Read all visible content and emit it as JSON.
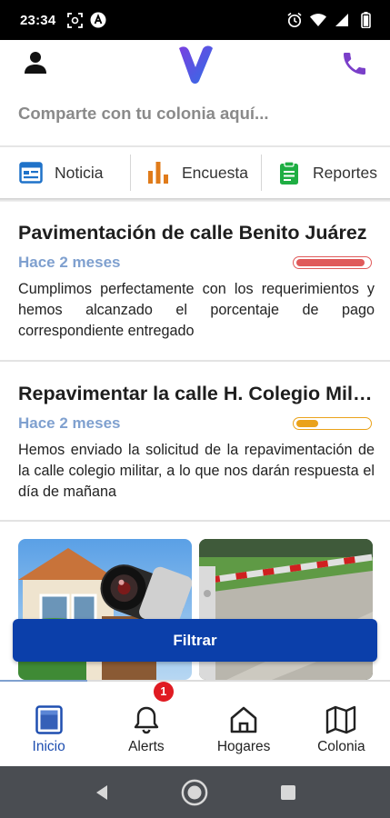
{
  "status_bar": {
    "time": "23:34",
    "left_icons": [
      "screenshot-icon",
      "app-icon"
    ],
    "right_icons": [
      "alarm-icon",
      "wifi-icon",
      "signal-icon",
      "battery-icon"
    ]
  },
  "header": {
    "share_placeholder": "Comparte con tu colonia aquí...",
    "logo_color": "#5a3fd6",
    "phone_color": "#7a3fc9"
  },
  "categories": [
    {
      "label": "Noticia",
      "icon": "newspaper-icon",
      "color": "#1f72c9"
    },
    {
      "label": "Encuesta",
      "icon": "bar-chart-icon",
      "color": "#e07b1a"
    },
    {
      "label": "Reportes",
      "icon": "clipboard-icon",
      "color": "#1fae43"
    }
  ],
  "posts": [
    {
      "title": "Pavimentación de calle Benito Juárez",
      "time": "Hace 2 meses",
      "progress": 0.95,
      "progress_color": "#e05a5a",
      "body": "Cumplimos perfectamente con los requerimientos y hemos alcanzado el porcentaje de pago correspondiente entregado"
    },
    {
      "title": "Repavimentar la calle H. Colegio Militar",
      "time": "Hace 2 meses",
      "progress": 0.3,
      "progress_color": "#eaa21a",
      "body": "Hemos enviado la solicitud de la repavimentación de la calle colegio militar, a lo que nos darán respuesta el día de mañana"
    }
  ],
  "gallery": [
    "security-camera-photo",
    "parking-barrier-photo"
  ],
  "filter_label": "Filtrar",
  "bottom_nav": [
    {
      "label": "Inicio",
      "icon": "home-screen-icon",
      "active": true
    },
    {
      "label": "Alerts",
      "icon": "bell-icon",
      "badge": "1"
    },
    {
      "label": "Hogares",
      "icon": "house-icon"
    },
    {
      "label": "Colonia",
      "icon": "map-icon"
    }
  ],
  "system_nav": [
    "back-icon",
    "home-icon",
    "recents-icon"
  ]
}
